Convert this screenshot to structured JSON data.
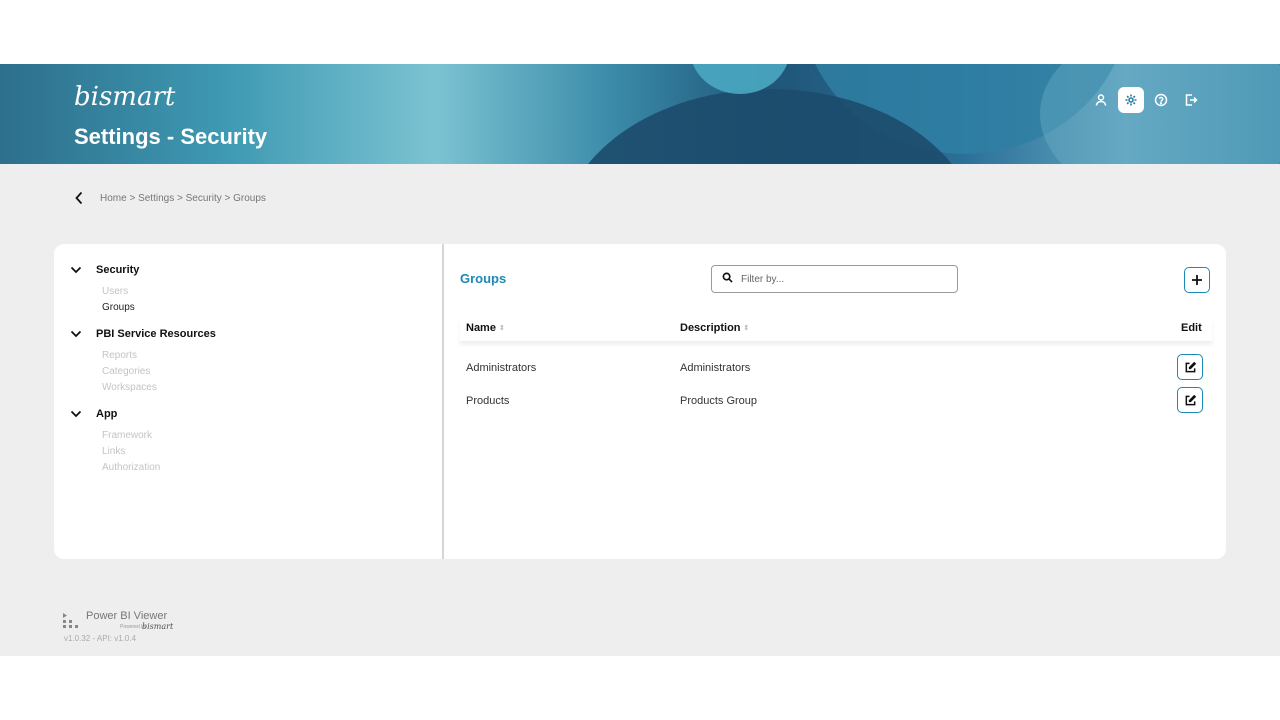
{
  "header": {
    "brand": "bismart",
    "title": "Settings - Security",
    "icons": [
      "user-icon",
      "settings-icon",
      "help-icon",
      "logout-icon"
    ],
    "active_icon": "settings-icon"
  },
  "breadcrumb": {
    "text": "Home > Settings > Security > Groups"
  },
  "sidebar": {
    "groups": [
      {
        "title": "Security",
        "items": [
          {
            "label": "Users",
            "active": false
          },
          {
            "label": "Groups",
            "active": true
          }
        ]
      },
      {
        "title": "PBI Service Resources",
        "items": [
          {
            "label": "Reports",
            "active": false
          },
          {
            "label": "Categories",
            "active": false
          },
          {
            "label": "Workspaces",
            "active": false
          }
        ]
      },
      {
        "title": "App",
        "items": [
          {
            "label": "Framework",
            "active": false
          },
          {
            "label": "Links",
            "active": false
          },
          {
            "label": "Authorization",
            "active": false
          }
        ]
      }
    ]
  },
  "main": {
    "title": "Groups",
    "filter_placeholder": "Filter by...",
    "columns": {
      "name": "Name",
      "description": "Description",
      "edit": "Edit"
    },
    "rows": [
      {
        "name": "Administrators",
        "description": "Administrators"
      },
      {
        "name": "Products",
        "description": "Products Group"
      }
    ]
  },
  "footer": {
    "title": "Power BI Viewer",
    "powered_by": "Powered by",
    "brand": "bismart",
    "version": "v1.0.32 - API: v1.0.4"
  },
  "colors": {
    "accent": "#1e88b4",
    "background": "#eeeeee",
    "card": "#ffffff"
  }
}
